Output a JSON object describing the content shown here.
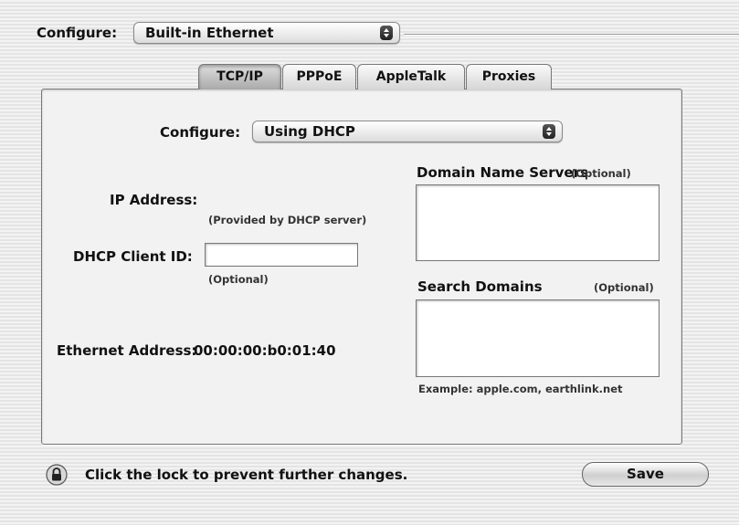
{
  "top": {
    "configure_label": "Configure:",
    "configure_value": "Built-in Ethernet"
  },
  "tabs": [
    {
      "label": "TCP/IP",
      "active": true
    },
    {
      "label": "PPPoE",
      "active": false
    },
    {
      "label": "AppleTalk",
      "active": false
    },
    {
      "label": "Proxies",
      "active": false
    }
  ],
  "tcpip": {
    "configure_label": "Configure:",
    "configure_value": "Using DHCP",
    "ip_address_label": "IP Address:",
    "ip_address_note": "(Provided by DHCP server)",
    "dhcp_client_id_label": "DHCP Client ID:",
    "dhcp_client_id_value": "",
    "dhcp_client_id_note": "(Optional)",
    "ethernet_address_label": "Ethernet Address:",
    "ethernet_address_value": "00:00:00:b0:01:40",
    "dns_label": "Domain Name Servers",
    "dns_optional": "(Optional)",
    "dns_value": "",
    "search_domains_label": "Search Domains",
    "search_domains_optional": "(Optional)",
    "search_domains_value": "",
    "example_text": "Example: apple.com, earthlink.net"
  },
  "footer": {
    "lock_text": "Click the lock to prevent further changes.",
    "save_label": "Save"
  },
  "icons": {
    "lock": "lock-icon",
    "popup_arrows": "updown-arrows-icon"
  }
}
